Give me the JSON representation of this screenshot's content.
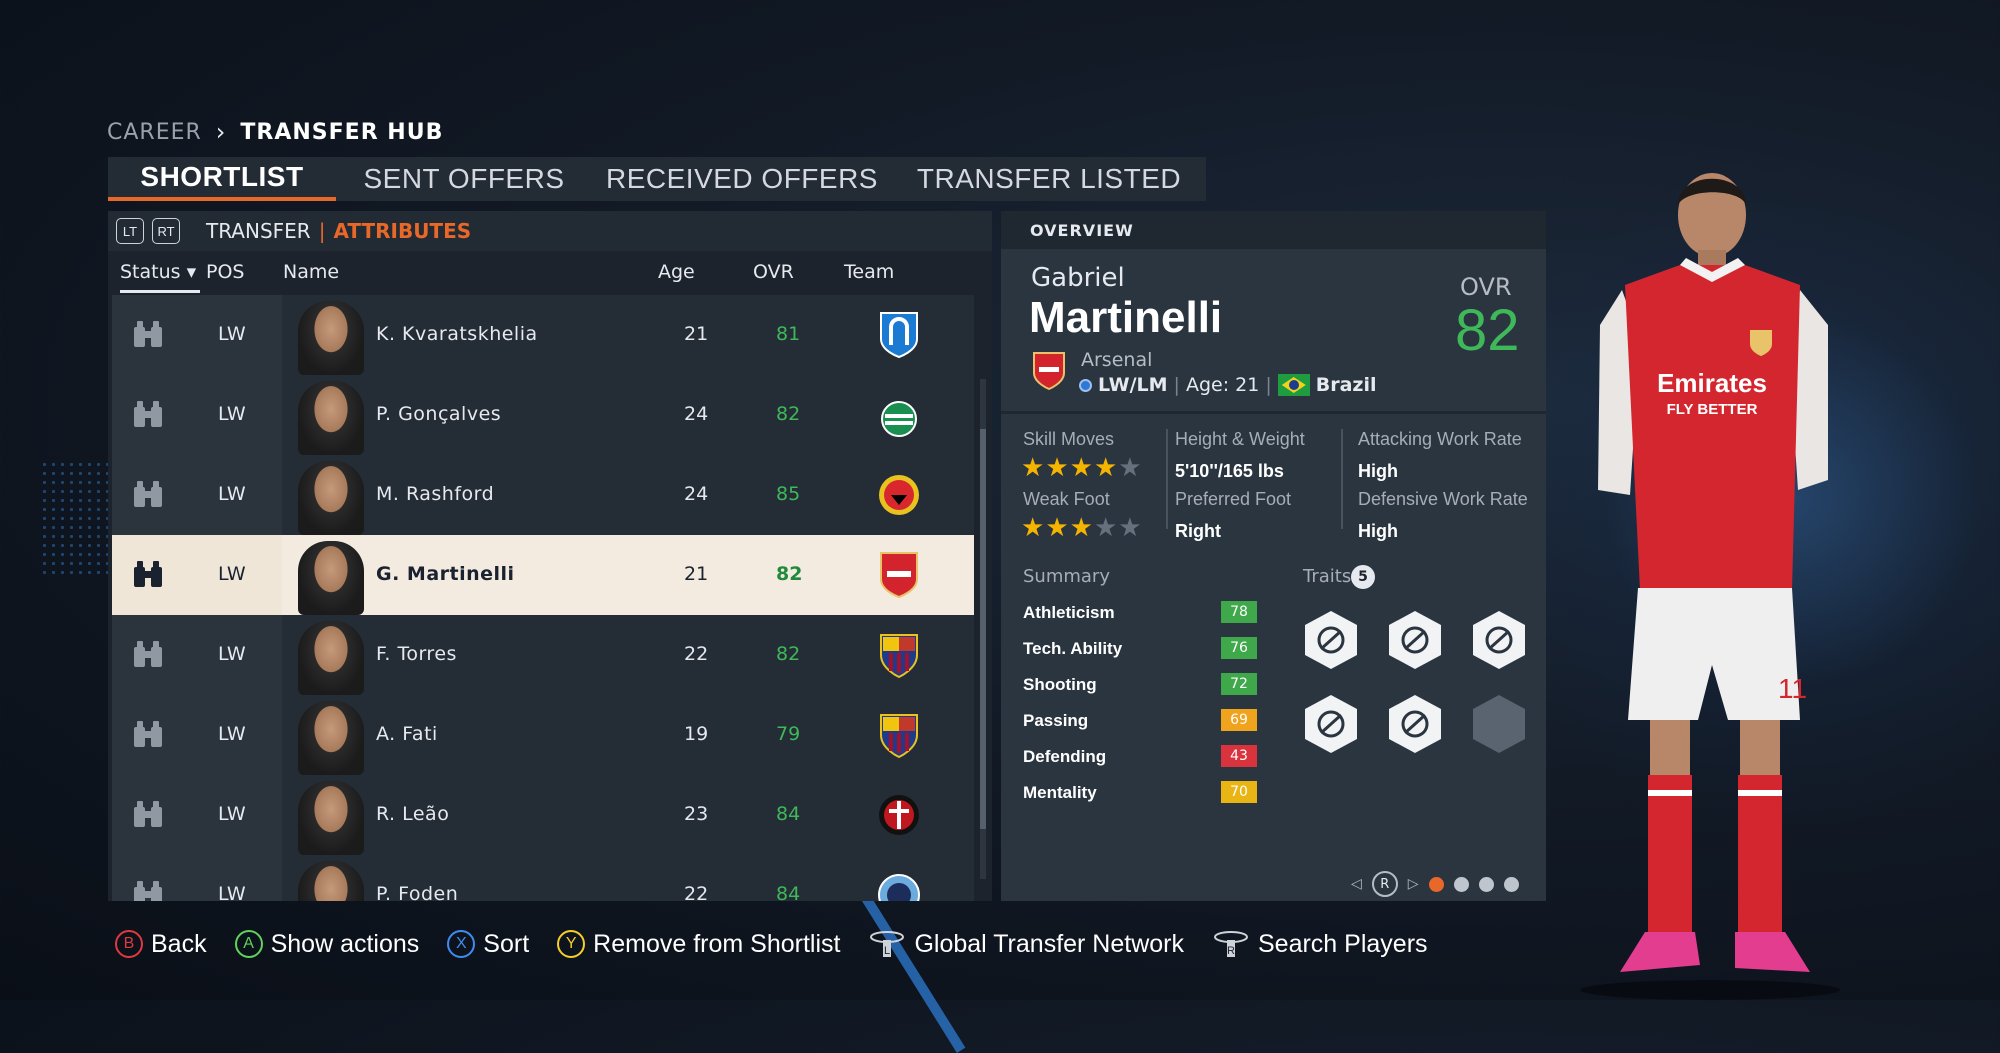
{
  "breadcrumb": {
    "parent": "CAREER",
    "separator": "›",
    "current": "TRANSFER HUB"
  },
  "tabs": [
    "SHORTLIST",
    "SENT OFFERS",
    "RECEIVED OFFERS",
    "TRANSFER LISTED"
  ],
  "subbar": {
    "lt": "LT",
    "rt": "RT",
    "transfer": "TRANSFER",
    "divider": "|",
    "attributes": "ATTRIBUTES"
  },
  "columns": {
    "status": "Status ▾",
    "pos": "POS",
    "name": "Name",
    "age": "Age",
    "ovr": "OVR",
    "team": "Team"
  },
  "players": [
    {
      "pos": "LW",
      "name": "K. Kvaratskhelia",
      "age": "21",
      "ovr": "81",
      "team": "napoli",
      "selected": false
    },
    {
      "pos": "LW",
      "name": "P. Gonçalves",
      "age": "24",
      "ovr": "82",
      "team": "sporting",
      "selected": false
    },
    {
      "pos": "LW",
      "name": "M. Rashford",
      "age": "24",
      "ovr": "85",
      "team": "man-united",
      "selected": false
    },
    {
      "pos": "LW",
      "name": "G. Martinelli",
      "age": "21",
      "ovr": "82",
      "team": "arsenal",
      "selected": true
    },
    {
      "pos": "LW",
      "name": "F. Torres",
      "age": "22",
      "ovr": "82",
      "team": "barcelona",
      "selected": false
    },
    {
      "pos": "LW",
      "name": "A. Fati",
      "age": "19",
      "ovr": "79",
      "team": "barcelona",
      "selected": false
    },
    {
      "pos": "LW",
      "name": "R. Leão",
      "age": "23",
      "ovr": "84",
      "team": "milan",
      "selected": false
    },
    {
      "pos": "LW",
      "name": "P. Foden",
      "age": "22",
      "ovr": "84",
      "team": "man-city",
      "selected": false
    }
  ],
  "overview": {
    "header": "OVERVIEW",
    "first_name": "Gabriel",
    "last_name": "Martinelli",
    "ovr_label": "OVR",
    "ovr": "82",
    "club": "Arsenal",
    "positions": "LW/LM",
    "age_text": "Age: 21",
    "separator": "|",
    "nationality": "Brazil",
    "skill_moves_label": "Skill Moves",
    "skill_moves_stars": 4,
    "weak_foot_label": "Weak Foot",
    "weak_foot_stars": 3,
    "height_weight_label": "Height & Weight",
    "height_weight": "5'10''/165 lbs",
    "preferred_foot_label": "Preferred Foot",
    "preferred_foot": "Right",
    "att_work_label": "Attacking Work Rate",
    "att_work": "High",
    "def_work_label": "Defensive Work Rate",
    "def_work": "High",
    "summary_label": "Summary",
    "stats": [
      {
        "name": "Athleticism",
        "value": "78",
        "color": "#3fa84a"
      },
      {
        "name": "Tech. Ability",
        "value": "76",
        "color": "#3fa84a"
      },
      {
        "name": "Shooting",
        "value": "72",
        "color": "#3fa84a"
      },
      {
        "name": "Passing",
        "value": "69",
        "color": "#f0a31c"
      },
      {
        "name": "Defending",
        "value": "43",
        "color": "#d9343d"
      },
      {
        "name": "Mentality",
        "value": "70",
        "color": "#e8b515"
      }
    ],
    "traits_label": "Traits",
    "traits_count": "5",
    "pager_button": "R"
  },
  "actions": [
    {
      "button": "B",
      "label": "Back"
    },
    {
      "button": "A",
      "label": "Show actions"
    },
    {
      "button": "X",
      "label": "Sort"
    },
    {
      "button": "Y",
      "label": "Remove from Shortlist"
    },
    {
      "button": "L",
      "label": "Global Transfer Network"
    },
    {
      "button": "R",
      "label": "Search Players"
    }
  ],
  "colors": {
    "accent": "#e8682a",
    "ovr_green": "#3fb85a",
    "panel": "#2a3540"
  }
}
